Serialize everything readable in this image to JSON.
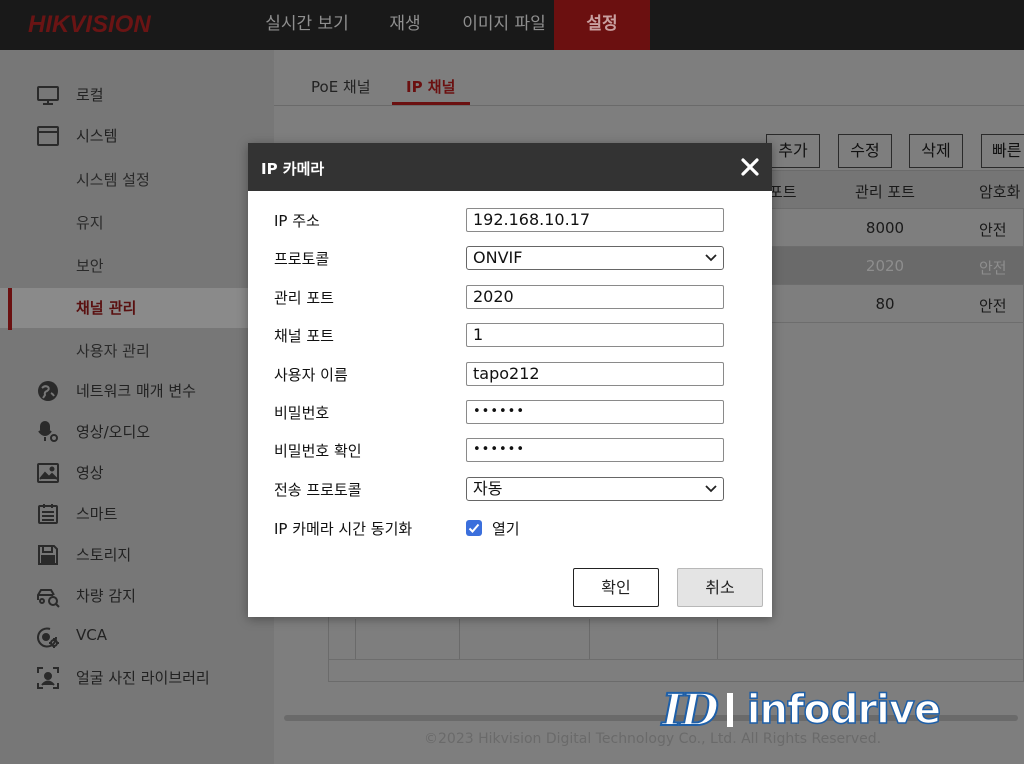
{
  "brand": {
    "logo": "HIKVISION"
  },
  "nav": [
    {
      "label": "실시간 보기"
    },
    {
      "label": "재생"
    },
    {
      "label": "이미지 파일"
    },
    {
      "label": "설정",
      "active": true
    }
  ],
  "sidebar": {
    "items": [
      {
        "label": "로컬",
        "icon": "monitor-icon"
      },
      {
        "label": "시스템",
        "icon": "window-icon"
      },
      {
        "label": "시스템 설정",
        "sub": true
      },
      {
        "label": "유지",
        "sub": true
      },
      {
        "label": "보안",
        "sub": true
      },
      {
        "label": "채널 관리",
        "sub": true,
        "selected": true
      },
      {
        "label": "사용자 관리",
        "sub": true
      },
      {
        "label": "네트워크 매개 변수",
        "icon": "globe-icon"
      },
      {
        "label": "영상/오디오",
        "icon": "microphone-icon"
      },
      {
        "label": "영상",
        "icon": "image-icon"
      },
      {
        "label": "스마트",
        "icon": "calendar-icon"
      },
      {
        "label": "스토리지",
        "icon": "floppy-icon"
      },
      {
        "label": "차량 감지",
        "icon": "car-search-icon"
      },
      {
        "label": "VCA",
        "icon": "camera-settings-icon"
      },
      {
        "label": "얼굴 사진 라이브러리",
        "icon": "face-frame-icon"
      }
    ]
  },
  "tabs": [
    {
      "label": "PoE 채널"
    },
    {
      "label": "IP 채널",
      "active": true
    }
  ],
  "toolbar": {
    "add": "추가",
    "edit": "수정",
    "delete": "삭제",
    "quick": "빠른"
  },
  "table": {
    "headers": [
      "포트",
      "관리 포트",
      "암호화"
    ],
    "rows": [
      {
        "mgmt_port": "8000",
        "security": "안전"
      },
      {
        "mgmt_port": "2020",
        "security": "안전",
        "highlighted": true
      },
      {
        "mgmt_port": "80",
        "security": "안전"
      }
    ]
  },
  "footer": "©2023 Hikvision Digital Technology Co., Ltd. All Rights Reserved.",
  "watermark": {
    "mark": "ID",
    "text": "infodrive"
  },
  "modal": {
    "title": "IP 카메라",
    "fields": {
      "ip_label": "IP 주소",
      "ip_value": "192.168.10.17",
      "protocol_label": "프로토콜",
      "protocol_value": "ONVIF",
      "mgmt_port_label": "관리 포트",
      "mgmt_port_value": "2020",
      "channel_port_label": "채널 포트",
      "channel_port_value": "1",
      "username_label": "사용자 이름",
      "username_value": "tapo212",
      "password_label": "비밀번호",
      "password_value": "••••••",
      "confirm_label": "비밀번호 확인",
      "confirm_value": "••••••",
      "transport_label": "전송 프로토콜",
      "transport_value": "자동",
      "sync_label": "IP 카메라 시간 동기화",
      "sync_checked": true,
      "sync_option": "열기"
    },
    "ok": "확인",
    "cancel": "취소"
  },
  "colors": {
    "accent": "#6b1010",
    "checkbox": "#3b6fdc",
    "modal_header": "#333333"
  }
}
